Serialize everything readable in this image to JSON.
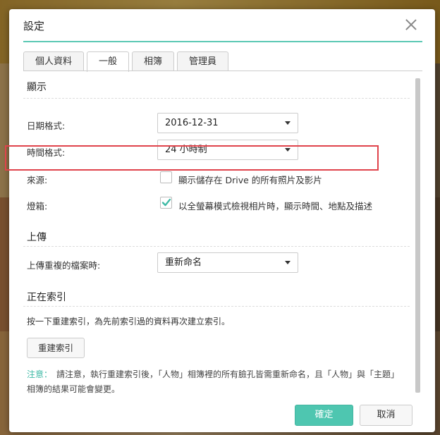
{
  "dialog": {
    "title": "設定",
    "tabs": [
      {
        "label": "個人資料"
      },
      {
        "label": "一般"
      },
      {
        "label": "相簿"
      },
      {
        "label": "管理員"
      }
    ],
    "active_tab": "一般"
  },
  "display": {
    "section_title": "顯示",
    "date_format_label": "日期格式:",
    "date_format_value": "2016-12-31",
    "time_format_label": "時間格式:",
    "time_format_value": "24 小時制",
    "source_label": "來源:",
    "source_checkbox_label": "顯示儲存在 Drive 的所有照片及影片",
    "source_checked": false,
    "lightbox_label": "燈箱:",
    "lightbox_checkbox_label": "以全螢幕模式檢視相片時，顯示時間、地點及描述",
    "lightbox_checked": true
  },
  "upload": {
    "section_title": "上傳",
    "duplicate_label": "上傳重複的檔案時:",
    "duplicate_value": "重新命名"
  },
  "indexing": {
    "section_title": "正在索引",
    "description": "按一下重建索引，為先前索引過的資料再次建立索引。",
    "rebuild_button": "重建索引",
    "note_label": "注意：",
    "note_text": "請注意，執行重建索引後，「人物」相簿裡的所有臉孔皆需重新命名，且「人物」與「主題」相簿的結果可能會變更。"
  },
  "footer": {
    "ok_label": "確定",
    "cancel_label": "取消"
  },
  "colors": {
    "accent": "#4ec6b0",
    "highlight_border": "#e0434b"
  }
}
